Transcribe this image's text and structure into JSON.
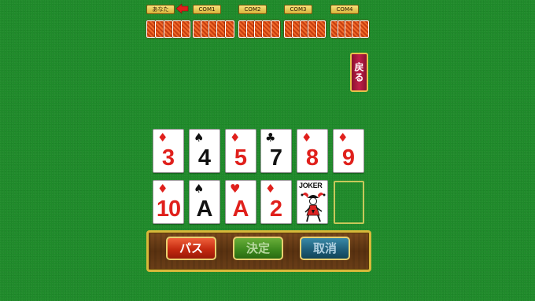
{
  "players": [
    {
      "label": "あなた"
    },
    {
      "label": "COM1"
    },
    {
      "label": "COM2"
    },
    {
      "label": "COM3"
    },
    {
      "label": "COM4"
    }
  ],
  "current_turn_indicator": "arrow-left-icon",
  "back_button_label": "戻る",
  "board": {
    "row1": [
      {
        "rank": "3",
        "suit": "♦",
        "color": "red"
      },
      {
        "rank": "4",
        "suit": "♠",
        "color": "black"
      },
      {
        "rank": "5",
        "suit": "♦",
        "color": "red"
      },
      {
        "rank": "7",
        "suit": "♣",
        "color": "black"
      },
      {
        "rank": "8",
        "suit": "♦",
        "color": "red"
      },
      {
        "rank": "9",
        "suit": "♦",
        "color": "red"
      }
    ],
    "row2": [
      {
        "rank": "10",
        "suit": "♦",
        "color": "red"
      },
      {
        "rank": "A",
        "suit": "♠",
        "color": "black"
      },
      {
        "rank": "A",
        "suit": "♥",
        "color": "red"
      },
      {
        "rank": "2",
        "suit": "♦",
        "color": "red"
      },
      {
        "rank": "JOKER",
        "suit": "",
        "color": "black"
      }
    ]
  },
  "actions": {
    "pass": "パス",
    "decide": "決定",
    "cancel": "取消"
  },
  "colors": {
    "felt": "#1f8a2a",
    "card_back": "#e0551e",
    "panel_wood": "#6a3e18",
    "gold": "#d8b83a"
  }
}
